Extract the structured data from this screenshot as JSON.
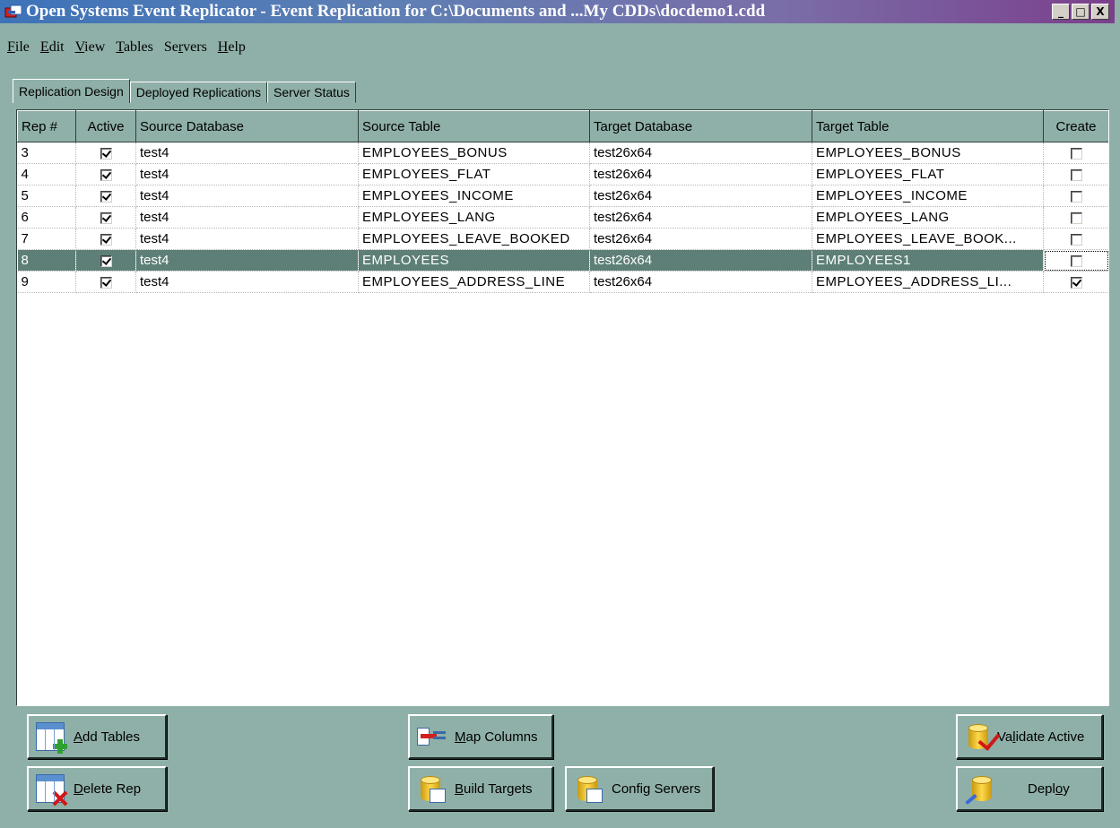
{
  "window": {
    "title": "Open Systems Event Replicator - Event Replication for C:\\Documents and ...My CDDs\\docdemo1.cdd",
    "controls": [
      "_",
      "□",
      "X"
    ]
  },
  "menu": [
    {
      "pre": "",
      "u": "F",
      "post": "ile"
    },
    {
      "pre": "",
      "u": "E",
      "post": "dit"
    },
    {
      "pre": "",
      "u": "V",
      "post": "iew"
    },
    {
      "pre": "",
      "u": "T",
      "post": "ables"
    },
    {
      "pre": "Se",
      "u": "r",
      "post": "vers"
    },
    {
      "pre": "",
      "u": "H",
      "post": "elp"
    }
  ],
  "tabs": [
    "Replication Design",
    "Deployed Replications",
    "Server Status"
  ],
  "grid": {
    "columns": [
      "Rep #",
      "Active",
      "Source Database",
      "Source Table",
      "Target Database",
      "Target Table",
      "Create"
    ],
    "rows": [
      {
        "rep": "3",
        "active": true,
        "src_db": "test4",
        "src_table": "EMPLOYEES_BONUS",
        "tgt_db": "test26x64",
        "tgt_table": "EMPLOYEES_BONUS",
        "create": false
      },
      {
        "rep": "4",
        "active": true,
        "src_db": "test4",
        "src_table": "EMPLOYEES_FLAT",
        "tgt_db": "test26x64",
        "tgt_table": "EMPLOYEES_FLAT",
        "create": false
      },
      {
        "rep": "5",
        "active": true,
        "src_db": "test4",
        "src_table": "EMPLOYEES_INCOME",
        "tgt_db": "test26x64",
        "tgt_table": "EMPLOYEES_INCOME",
        "create": false
      },
      {
        "rep": "6",
        "active": true,
        "src_db": "test4",
        "src_table": "EMPLOYEES_LANG",
        "tgt_db": "test26x64",
        "tgt_table": "EMPLOYEES_LANG",
        "create": false
      },
      {
        "rep": "7",
        "active": true,
        "src_db": "test4",
        "src_table": "EMPLOYEES_LEAVE_BOOKED",
        "tgt_db": "test26x64",
        "tgt_table": "EMPLOYEES_LEAVE_BOOK...",
        "create": false
      },
      {
        "rep": "8",
        "active": true,
        "src_db": "test4",
        "src_table": "EMPLOYEES",
        "tgt_db": "test26x64",
        "tgt_table": "EMPLOYEES1",
        "create": false,
        "selected": true
      },
      {
        "rep": "9",
        "active": true,
        "src_db": "test4",
        "src_table": "EMPLOYEES_ADDRESS_LINE",
        "tgt_db": "test26x64",
        "tgt_table": "EMPLOYEES_ADDRESS_LI...",
        "create": true
      }
    ]
  },
  "buttons": {
    "add_tables": {
      "pre": "",
      "u": "A",
      "post": "dd Tables"
    },
    "delete_rep": {
      "pre": "",
      "u": "D",
      "post": "elete Rep"
    },
    "map_columns": {
      "pre": "",
      "u": "M",
      "post": "ap Columns"
    },
    "build_targets": {
      "pre": "",
      "u": "B",
      "post": "uild Targets"
    },
    "config_servers": {
      "pre": "Confi",
      "u": "g",
      "post": " Servers"
    },
    "validate_active": {
      "pre": "Va",
      "u": "l",
      "post": "idate Active"
    },
    "deploy": {
      "pre": "Depl",
      "u": "o",
      "post": "y"
    }
  }
}
